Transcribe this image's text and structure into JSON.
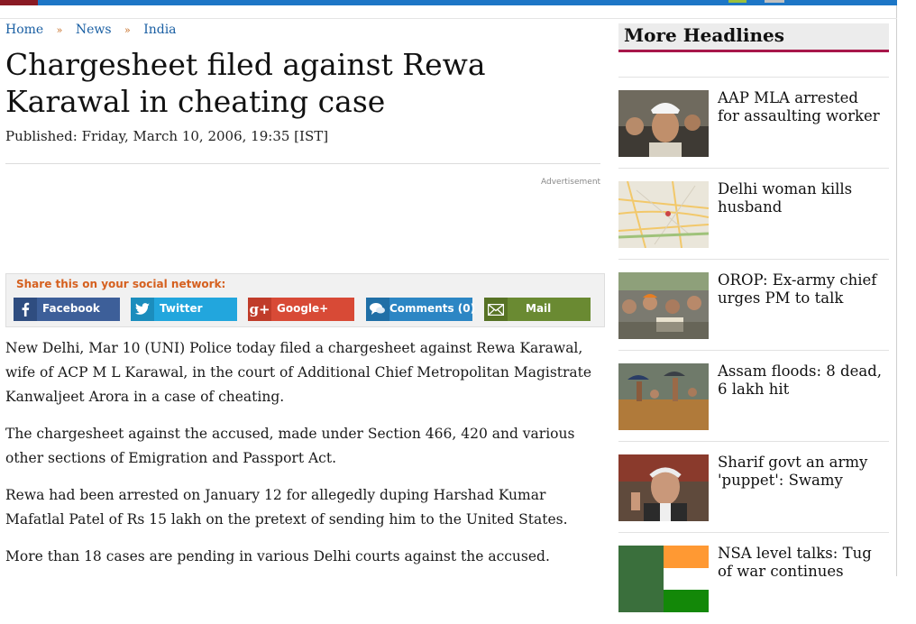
{
  "breadcrumb": [
    "Home",
    "News",
    "India"
  ],
  "article": {
    "title": "Chargesheet filed against Rewa Karawal in cheating case",
    "published": "Published: Friday, March 10, 2006, 19:35 [IST]",
    "ad_label": "Advertisement",
    "paragraphs": [
      "New Delhi, Mar 10 (UNI) Police today filed a chargesheet against Rewa Karawal, wife of ACP M L Karawal, in the court of Additional Chief Metropolitan Magistrate Kanwaljeet Arora in a case of cheating.",
      "The chargesheet against the accused, made under Section 466, 420 and various other sections of Emigration and Passport Act.",
      "Rewa had been arrested on January 12 for allegedly duping Harshad Kumar Mafatlal Patel of Rs 15 lakh on the pretext of sending him to the United States.",
      "More than 18 cases are pending in various Delhi courts against the accused."
    ]
  },
  "share": {
    "label": "Share this on your social network:",
    "buttons": [
      {
        "label": "Facebook",
        "icon": "facebook-icon",
        "color": "#3d5f99"
      },
      {
        "label": "Twitter",
        "icon": "twitter-icon",
        "color": "#22a6dd"
      },
      {
        "label": "Google+",
        "icon": "google-plus-icon",
        "color": "#d84a36"
      },
      {
        "label": "Comments (0)",
        "icon": "comments-icon",
        "color": "#2c86c4"
      },
      {
        "label": "Mail",
        "icon": "mail-icon",
        "color": "#6a8a32"
      }
    ]
  },
  "sidebar": {
    "title": "More Headlines",
    "items": [
      {
        "headline": "AAP MLA arrested for assaulting worker"
      },
      {
        "headline": "Delhi woman kills husband"
      },
      {
        "headline": "OROP: Ex-army chief urges PM to talk"
      },
      {
        "headline": "Assam floods: 8 dead, 6 lakh hit"
      },
      {
        "headline": "Sharif govt an army 'puppet': Swamy"
      },
      {
        "headline": "NSA level talks: Tug of war continues"
      }
    ]
  }
}
